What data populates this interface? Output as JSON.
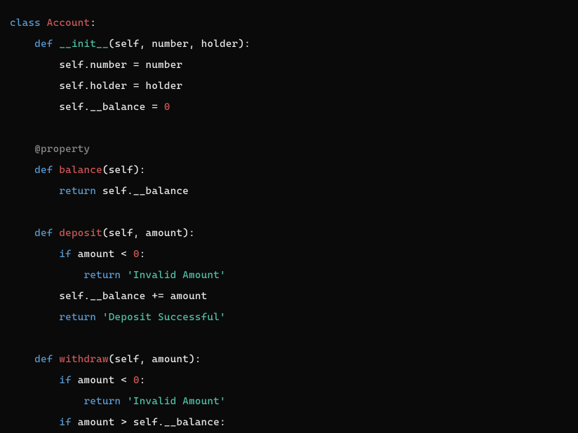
{
  "code": {
    "kw_class": "class",
    "cls_name": "Account",
    "kw_def": "def",
    "fn_init": "__init__",
    "param_self": "self",
    "param_number": "number",
    "param_holder": "holder",
    "param_amount": "amount",
    "assign_number": "self.number = number",
    "assign_holder": "self.holder = holder",
    "assign_balance_prefix": "self.__balance = ",
    "zero": "0",
    "decorator": "@property",
    "fn_balance": "balance",
    "kw_return": "return",
    "ret_balance": " self.__balance",
    "fn_deposit": "deposit",
    "kw_if": "if",
    "cond_lt_zero": " amount < ",
    "str_invalid": "'Invalid Amount'",
    "stmt_add_balance": "self.__balance += amount",
    "str_deposit_ok": "'Deposit Successful'",
    "fn_withdraw": "withdraw",
    "cond_gt_balance": " amount > self.__balance:",
    "colon": ":",
    "paren_open": "(",
    "paren_close": ")",
    "comma_sp": ", ",
    "space": " "
  }
}
